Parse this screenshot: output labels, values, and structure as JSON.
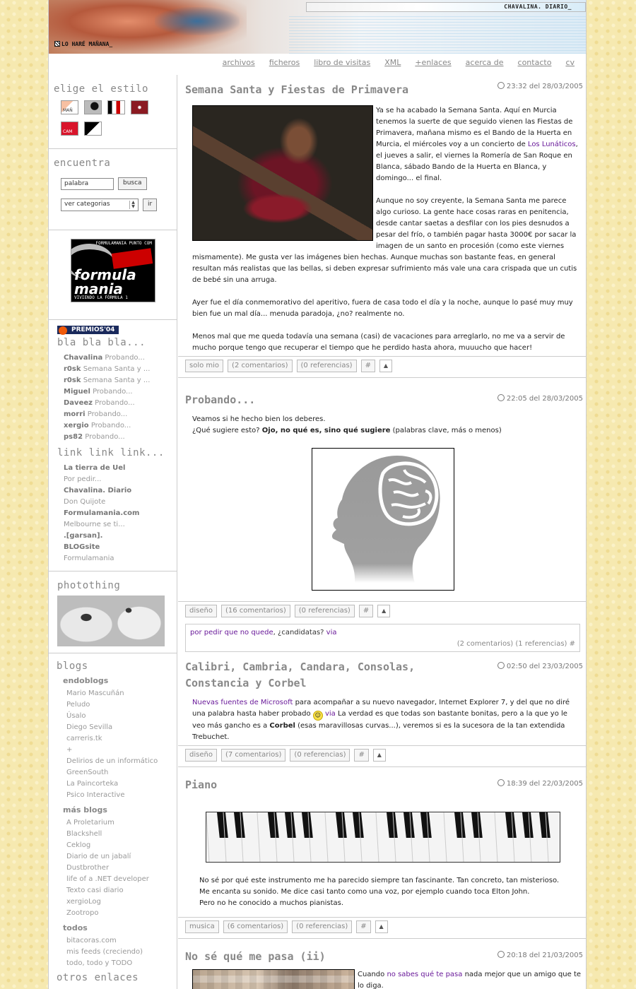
{
  "header": {
    "site_name": "CHAVALINA. DIARIO_",
    "tagline": "LO HARÉ MAÑANA_"
  },
  "nav": [
    "archivos",
    "ficheros",
    "libro de visitas",
    "XML",
    "+enlaces",
    "acerca de",
    "contacto",
    "cv"
  ],
  "sidebar": {
    "style_title": "elige el estilo",
    "style_labels": [
      "MAÑ",
      "",
      "",
      "",
      "CAM",
      ""
    ],
    "search_title": "encuentra",
    "search_value": "palabra",
    "search_button": "busca",
    "category_select": "ver categorias",
    "go_button": "ir",
    "formula_logo": {
      "top": "FORMULAMANIA PUNTO COM",
      "word": "formula mania",
      "sub": "VIVIENDO LA FÓRMULA 1"
    },
    "premios": "PREMIOS'04",
    "comments_title": "bla bla bla...",
    "comments": [
      {
        "author": "Chavalina",
        "text": "Probando..."
      },
      {
        "author": "r0sk",
        "text": "Semana Santa y ..."
      },
      {
        "author": "r0sk",
        "text": "Semana Santa y ..."
      },
      {
        "author": "Miguel",
        "text": "Probando..."
      },
      {
        "author": "Daveez",
        "text": "Probando..."
      },
      {
        "author": "morri",
        "text": "Probando..."
      },
      {
        "author": "xergio",
        "text": "Probando..."
      },
      {
        "author": "ps82",
        "text": "Probando..."
      }
    ],
    "links_title": "link link link...",
    "links": [
      {
        "author": "La tierra de Uel",
        "text": "Por pedir..."
      },
      {
        "author": "Chavalina. Diario",
        "text": "Don Quijote"
      },
      {
        "author": "Formulamania.com",
        "text": "Melbourne se ti..."
      },
      {
        "author": ".[garsan]. BLOGsite",
        "text": "Formulamania"
      }
    ],
    "photothing_title": "photothing",
    "blogs_title": "blogs",
    "blog_groups": [
      {
        "name": "endoblogs",
        "items": [
          "Mario Mascuñán",
          "Peludo",
          "Úsalo",
          "Diego Sevilla",
          "carreris.tk",
          "+",
          "Delirios de un informático",
          "GreenSouth",
          "La Paincorteka",
          "Psico Interactive"
        ]
      },
      {
        "name": "más blogs",
        "items": [
          "A Proletarium",
          "Blackshell",
          "Ceklog",
          "Diario de un jabalí",
          "Dustbrother",
          "life of a .NET developer",
          "Texto casi diario",
          "xergioLog",
          "Zootropo"
        ]
      },
      {
        "name": "todos",
        "items": [
          "bitacoras.com",
          "mis feeds (creciendo)",
          "todo, todo y TODO"
        ]
      }
    ],
    "other_links_title": "otros enlaces"
  },
  "posts": [
    {
      "title": "Semana Santa y Fiestas de Primavera",
      "date": "23:32 del 28/03/2005",
      "p1_a": "Ya se ha acabado la Semana Santa. Aquí en Murcia tenemos la suerte de que seguido vienen las Fiestas de Primavera, mañana mismo es el Bando de la Huerta en Murcia, el miércoles voy a un concierto de ",
      "p1_link": "Los Lunáticos",
      "p1_b": ", el jueves a salir, el viernes la Romería de San Roque en Blanca, sábado Bando de la Huerta en Blanca, y domingo... el final.",
      "p2": "Aunque no soy creyente, la Semana Santa me parece algo curioso. La gente hace cosas raras en penitencia, desde cantar saetas a desfilar con los pies desnudos a pesar del frío, o también pagar hasta 3000€ por sacar la imagen de un santo en procesión (como este viernes mismamente). Me gusta ver las imágenes bien hechas. Aunque muchas son bastante feas, en general resultan más realistas que las bellas, si deben expresar sufrimiento más vale una cara crispada que un cutis de bebé sin una arruga.",
      "p3": "Ayer fue el día conmemorativo del aperitivo, fuera de casa todo el día y la noche, aunque lo pasé muy muy bien fue un mal día... menuda paradoja, ¿no? realmente no.",
      "p4": "Menos mal que me queda todavía una semana (casi) de vacaciones para arreglarlo, no me va a servir de mucho porque tengo que recuperar el tiempo que he perdido hasta ahora, muuucho que hacer!",
      "category": "solo mio",
      "comments": "(2 comentarios)",
      "refs": "(0 referencias)"
    },
    {
      "title": "Probando...",
      "date": "22:05 del 28/03/2005",
      "line1": "Veamos si he hecho bien los deberes.",
      "line2_a": "¿Qué sugiere esto? ",
      "line2_bold": "Ojo, no qué es, sino qué sugiere",
      "line2_b": " (palabras clave, más o menos)",
      "category": "diseño",
      "comments": "(16 comentarios)",
      "refs": "(0 referencias)"
    },
    {
      "title": "Calibri, Cambria, Candara, Consolas, Constancia y Corbel",
      "date": "02:50 del 23/03/2005",
      "link1": "Nuevas fuentes de Microsoft",
      "text1": " para acompañar a su nuevo navegador, Internet Explorer 7, y del que no diré una palabra hasta haber probado ",
      "via": "via",
      "text2": " La verdad es que todas son bastante bonitas, pero a la que yo le veo más gancho es a ",
      "bold": "Corbel",
      "text3": " (esas maravillosas curvas...), veremos si es la sucesora de la tan extendida Trebuchet.",
      "category": "diseño",
      "comments": "(7 comentarios)",
      "refs": "(0 referencias)"
    },
    {
      "title": "Piano",
      "date": "18:39 del 22/03/2005",
      "line1": "No sé por qué este instrumento me ha parecido siempre tan fascinante. Tan concreto, tan misterioso.",
      "line2": "Me encanta su sonido. Me dice casi tanto como una voz, por ejemplo cuando toca Elton John.",
      "line3": "Pero no he conocido a muchos pianistas.",
      "category": "musica",
      "comments": "(6 comentarios)",
      "refs": "(0 referencias)"
    },
    {
      "title": "No sé qué me pasa (ii)",
      "date": "20:18 del 21/03/2005",
      "text_a": "Cuando ",
      "link": "no sabes qué te pasa",
      "text_b": " nada mejor que un amigo que te lo diga."
    }
  ],
  "aside": {
    "link1": "por pedir que no quede",
    "text": ", ¿candidatas? ",
    "via": "via",
    "meta": "(2 comentarios) (1 referencias) #"
  },
  "permalink": "#",
  "up_icon": "▲"
}
